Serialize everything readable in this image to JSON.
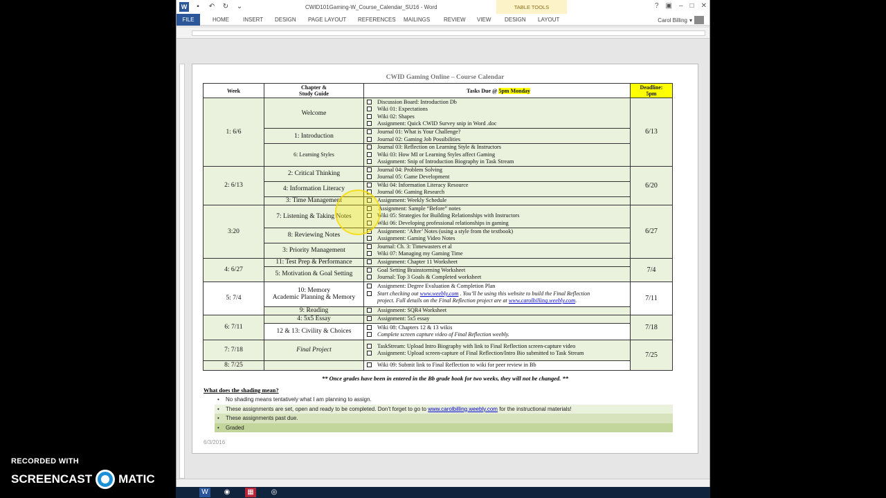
{
  "window": {
    "doc_title": "CWID101Gaming-W_Course_Calendar_SU16 - Word",
    "table_tools": "TABLE TOOLS",
    "user": "Carol Billing",
    "controls": [
      "?",
      "▣",
      "–",
      "□",
      "✕"
    ]
  },
  "ribbon": {
    "tabs": [
      "FILE",
      "HOME",
      "INSERT",
      "DESIGN",
      "PAGE LAYOUT",
      "REFERENCES",
      "MAILINGS",
      "REVIEW",
      "VIEW",
      "DESIGN",
      "LAYOUT"
    ]
  },
  "document": {
    "title": "CWID Gaming Online – Course Calendar",
    "headers": {
      "week": "Week",
      "chapter_a": "Chapter &",
      "chapter_b": "Study Guide",
      "tasks_prefix": "Tasks Due @ ",
      "tasks_hl": "5pm Monday",
      "deadline_a": "Deadline:",
      "deadline_b": "5pm"
    },
    "weeks": [
      {
        "label": "1: 6/6",
        "deadline": "6/13",
        "chapters": [
          {
            "name": "Welcome",
            "tasks": [
              "Discussion Board: Introduction Db",
              "Wiki 01: Expectations",
              "Wiki 02: Shapes",
              "Assignment: Quick CWID Survey snip in Word .doc"
            ]
          },
          {
            "name": "1: Introduction",
            "tasks": [
              "Journal 01: What is Your Challenge?",
              "Journal 02: Gaming Job Possibilities"
            ]
          },
          {
            "name": "6: Learning Styles",
            "tasks": [
              "Journal 03: Reflection on Learning Style & Instructors",
              "Wiki 03: How MI or Learning Styles affect Gaming",
              "Assignment: Snip of Introduction Biography in Task Stream"
            ]
          }
        ]
      },
      {
        "label": "2: 6/13",
        "deadline": "6/20",
        "chapters": [
          {
            "name": "2: Critical Thinking",
            "tasks": [
              "Journal 04: Problem Solving",
              "Journal 05: Game Development"
            ]
          },
          {
            "name": "4: Information Literacy",
            "tasks": [
              "Wiki 04: Information Literacy Resource",
              "Journal 06: Gaming Research"
            ]
          },
          {
            "name": "3: Time Management",
            "tasks": [
              "Assignment: Weekly Schedule"
            ]
          }
        ]
      },
      {
        "label": "3:20",
        "deadline": "6/27",
        "chapters": [
          {
            "name": "7: Listening & Taking Notes",
            "tasks": [
              " Assignment: Sample “Before” notes",
              "Wiki 05: Strategies for Building Relationships with Instructors",
              "Wiki 06: Developing professional relationships in gaming"
            ]
          },
          {
            "name": "8: Reviewing Notes",
            "tasks": [
              "Assignment: ‘After’ Notes (using a style from the textbook)",
              "Assignment: Gaming Video Notes"
            ]
          },
          {
            "name": "3: Priority Management",
            "tasks": [
              "Journal: Ch. 3: Timewasters et al",
              "Wiki 07: Managing my Gaming Time"
            ]
          }
        ]
      },
      {
        "label": "4: 6/27",
        "deadline": "7/4",
        "chapters": [
          {
            "name": "11: Test Prep & Performance",
            "tasks": [
              "Assignment: Chapter 11 Worksheet"
            ]
          },
          {
            "name": "5: Motivation & Goal Setting",
            "tasks": [
              "Goal Setting Brainstorming Worksheet",
              "Journal: Top 3 Goals & Completed worksheet"
            ]
          }
        ]
      },
      {
        "label": "5: 7/4",
        "deadline": "7/11",
        "chapters": [
          {
            "name": "10: Memory",
            "name2": "Academic Planning & Memory",
            "tasks": [
              "Assignment: Degree Evaluation & Completion Plan"
            ],
            "note_a": "Start checking out ",
            "note_link1": "www.weebly.com",
            "note_b": " . You’ll be using this website to build the Final Reflection",
            "note_c": "project. Full details on the Final Reflection project are at ",
            "note_link2": "www.carolbilling.weebly.com",
            "note_d": "."
          },
          {
            "name": "9: Reading",
            "tasks": [
              "Assignment: SQR4 Worksheet"
            ]
          }
        ]
      },
      {
        "label": "6: 7/11",
        "deadline": "7/18",
        "chapters": [
          {
            "name": "4: 5x5 Essay",
            "tasks": [
              "Assignment: 5x5 essay"
            ]
          },
          {
            "name": "12 & 13: Civility & Choices",
            "tasks": [
              "Wiki 08: Chapters 12 & 13 wikis"
            ],
            "italic_task": "Complete screen capture video of Final Reflection weebly."
          }
        ]
      },
      {
        "label": "7: 7/18",
        "deadline": "7/25",
        "chapters": [
          {
            "name": "Final Project",
            "tasks": [
              "TaskStream: Upload Intro Biography with link to Final Reflection screen-capture video",
              "Assignment: Upload screen-capture of Final Reflection/Intro Bio submitted to Task Stream"
            ]
          }
        ]
      },
      {
        "label": "8: 7/25",
        "deadline": "",
        "chapters": [
          {
            "name": "",
            "tasks": [
              "Wiki 09: Submit link to Final Reflection to wiki for peer review in Bb"
            ]
          }
        ]
      }
    ],
    "footnote": "** Once grades have been in entered in the Bb grade book for two weeks, they will not be changed. **",
    "shading_heading": "What does the shading mean?",
    "legend": {
      "l1": "No shading means tentatively what I am planning to assign.",
      "l2a": "These assignments are set, open and ready to be completed. Don’t forget to go to ",
      "l2link": "www.carolbilling.weebly.com",
      "l2b": " for the instructional materials!",
      "l3": "These assignments past due.",
      "l4": "Graded"
    },
    "date": "6/3/2016"
  },
  "watermark": {
    "line1": "RECORDED WITH",
    "left": "SCREENCAST",
    "right": "MATIC"
  },
  "colors": {
    "word_blue": "#2b579a",
    "shade_green": "#eaf1dd",
    "highlight": "#ffff00"
  }
}
